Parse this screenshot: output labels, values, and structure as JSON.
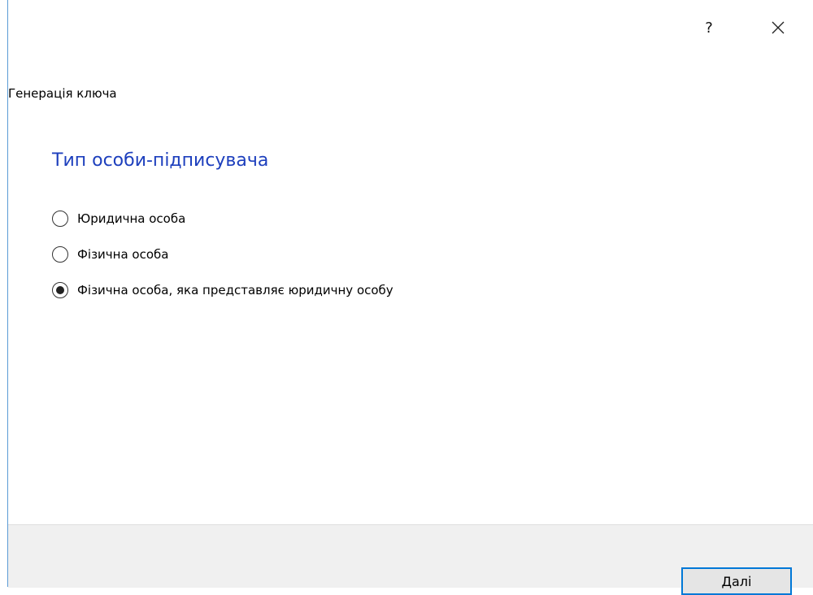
{
  "window": {
    "help_label": "?",
    "close_icon": "close-icon"
  },
  "header": {
    "breadcrumb": "Генерація  ключа"
  },
  "main": {
    "title": "Тип особи-підписувача",
    "options": [
      {
        "label": "Юридична особа",
        "checked": false
      },
      {
        "label": "Фізична особа",
        "checked": false
      },
      {
        "label": "Фізична особа, яка представляє юридичну особу",
        "checked": true
      }
    ]
  },
  "footer": {
    "next_label": "Далі"
  },
  "colors": {
    "title": "#1d3fbd",
    "accent": "#0078d7",
    "footer_bg": "#f0f0f0"
  }
}
